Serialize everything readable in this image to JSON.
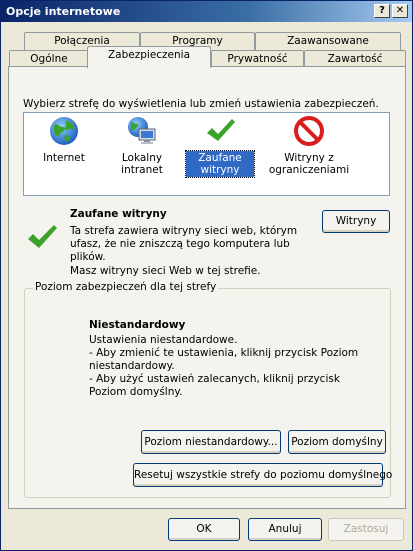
{
  "window": {
    "title": "Opcje internetowe",
    "help_glyph": "?",
    "close_glyph": "✕"
  },
  "tabs": {
    "row_top": [
      "Połączenia",
      "Programy",
      "Zaawansowane"
    ],
    "row_bottom": [
      "Ogólne",
      "Zabezpieczenia",
      "Prywatność",
      "Zawartość"
    ],
    "active": "Zabezpieczenia"
  },
  "security": {
    "instruction": "Wybierz strefę do wyświetlenia lub zmień ustawienia zabezpieczeń.",
    "zones": [
      {
        "label": "Internet",
        "icon": "globe-icon"
      },
      {
        "label": "Lokalny intranet",
        "icon": "intranet-icon"
      },
      {
        "label": "Zaufane witryny",
        "icon": "checkmark-icon",
        "selected": true
      },
      {
        "label": "Witryny z ograniczeniami",
        "icon": "restricted-icon"
      }
    ],
    "zone_title": "Zaufane witryny",
    "zone_desc": "Ta strefa zawiera witryny sieci web, którym ufasz, że nie zniszczą tego komputera lub plików.",
    "zone_sites_text": "Masz witryny sieci Web w tej strefie.",
    "sites_button": "Witryny",
    "level_group_title": "Poziom zabezpieczeń dla tej strefy",
    "level_title": "Niestandardowy",
    "level_lines": [
      "Ustawienia niestandardowe.",
      "- Aby zmienić te ustawienia, kliknij przycisk Poziom niestandardowy.",
      "- Aby użyć ustawień zalecanych, kliknij przycisk Poziom domyślny."
    ],
    "custom_level_button": "Poziom niestandardowy...",
    "default_level_button": "Poziom domyślny",
    "reset_button": "Resetuj wszystkie strefy do poziomu domyślnego"
  },
  "footer": {
    "ok": "OK",
    "cancel": "Anuluj",
    "apply": "Zastosuj"
  },
  "colors": {
    "accent": "#316ac5",
    "title_bar": "#0a246a",
    "check_green": "#3aa32a",
    "restricted_red": "#d81e1e"
  }
}
